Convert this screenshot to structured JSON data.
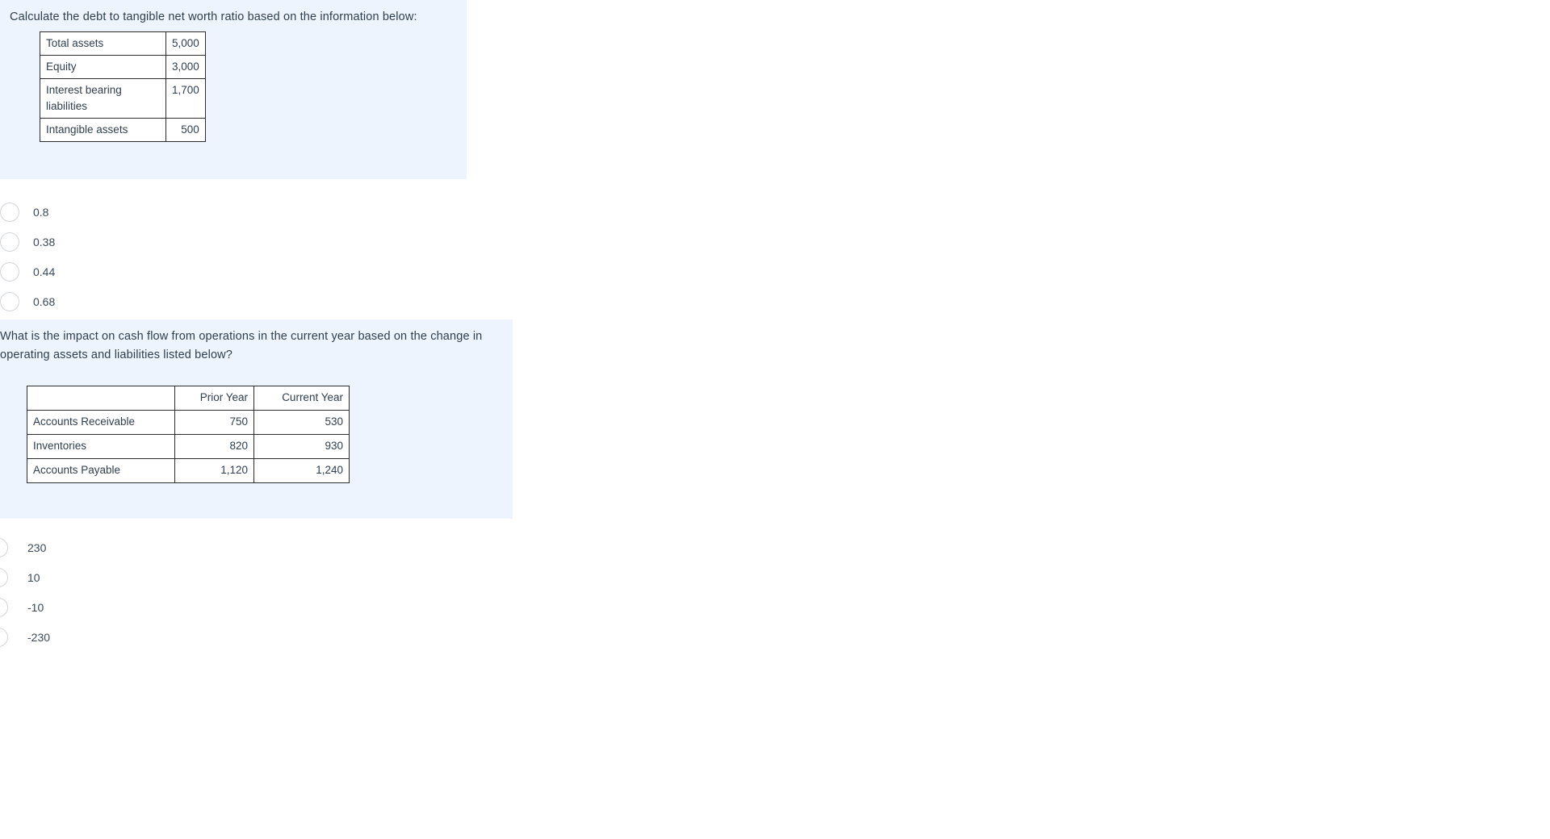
{
  "questions": [
    {
      "prompt": "Calculate the debt to tangible net worth ratio based on the information below:",
      "table": {
        "rows": [
          {
            "label": "Total assets",
            "value": "5,000"
          },
          {
            "label": "Equity",
            "value": "3,000"
          },
          {
            "label": "Interest bearing liabilities",
            "value": "1,700"
          },
          {
            "label": "Intangible assets",
            "value": "500"
          }
        ]
      },
      "options": [
        {
          "label": "0.8"
        },
        {
          "label": "0.38"
        },
        {
          "label": "0.44"
        },
        {
          "label": "0.68"
        }
      ]
    },
    {
      "prompt": "What is the impact on cash flow from operations in the current year based on the change in operating assets and liabilities listed below?",
      "table": {
        "headers": [
          "",
          "Prior Year",
          "Current Year"
        ],
        "rows": [
          {
            "label": "Accounts Receivable",
            "prior": "750",
            "current": "530"
          },
          {
            "label": "Inventories",
            "prior": "820",
            "current": "930"
          },
          {
            "label": "Accounts Payable",
            "prior": "1,120",
            "current": "1,240"
          }
        ]
      },
      "options": [
        {
          "label": "230"
        },
        {
          "label": "10"
        },
        {
          "label": "-10"
        },
        {
          "label": "-230"
        }
      ]
    }
  ],
  "colors": {
    "panel_background": "#edf4fd",
    "page_background": "#ffffff",
    "text": "#2f3e4f",
    "table_border": "#2c2c2c",
    "radio_border": "#d2d6da"
  }
}
